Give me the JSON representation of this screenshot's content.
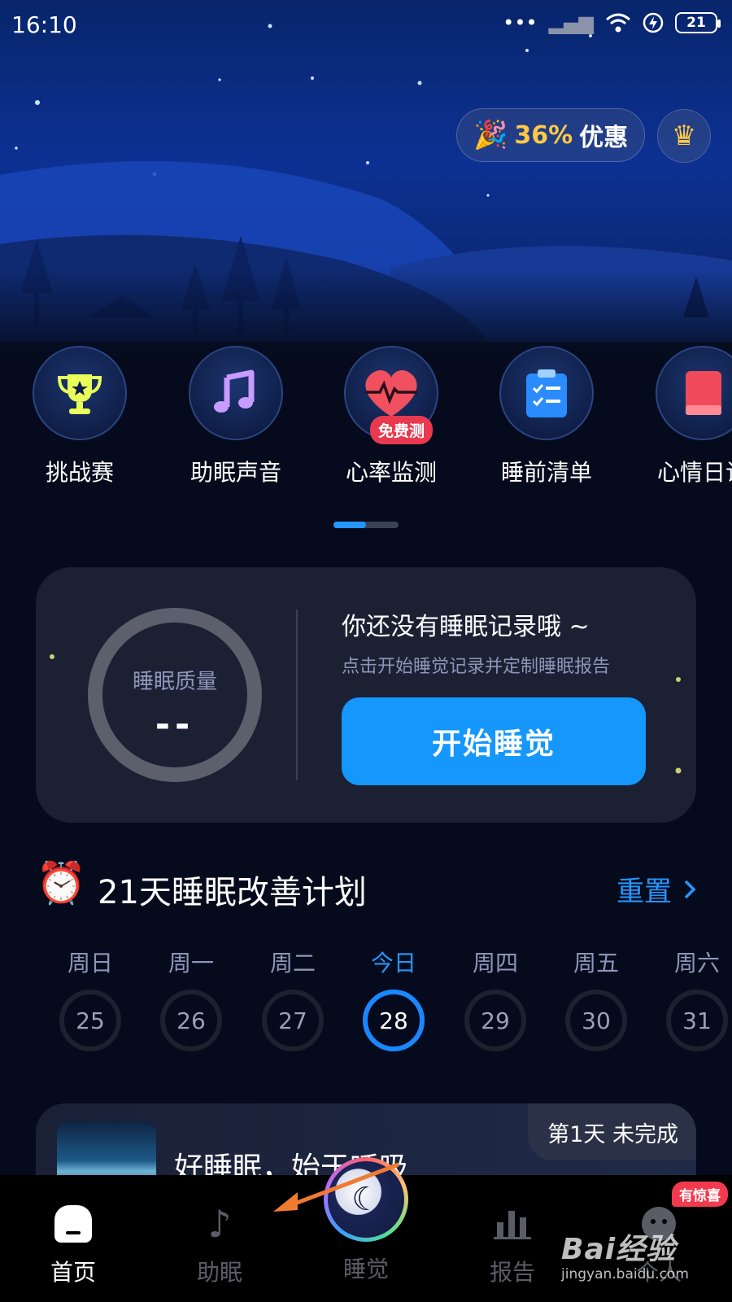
{
  "status_bar": {
    "time": "16:10",
    "battery": "21"
  },
  "promo": {
    "percent": "36%",
    "label": "优惠"
  },
  "shortcuts": [
    {
      "label": "挑战赛",
      "icon": "trophy-icon"
    },
    {
      "label": "助眠声音",
      "icon": "music-note-icon"
    },
    {
      "label": "心率监测",
      "icon": "heart-rate-icon",
      "badge": "免费测"
    },
    {
      "label": "睡前清单",
      "icon": "checklist-icon"
    },
    {
      "label": "心情日记",
      "icon": "diary-book-icon"
    }
  ],
  "sleep_card": {
    "quality_label": "睡眠质量",
    "quality_value": "--",
    "title": "你还没有睡眠记录哦 ~",
    "subtitle": "点击开始睡觉记录并定制睡眠报告",
    "start_button": "开始睡觉"
  },
  "plan": {
    "title": "21天睡眠改善计划",
    "reset_label": "重置",
    "days": [
      {
        "name": "周日",
        "date": "25",
        "active": false
      },
      {
        "name": "周一",
        "date": "26",
        "active": false
      },
      {
        "name": "周二",
        "date": "27",
        "active": false
      },
      {
        "name": "今日",
        "date": "28",
        "active": true
      },
      {
        "name": "周四",
        "date": "29",
        "active": false
      },
      {
        "name": "周五",
        "date": "30",
        "active": false
      },
      {
        "name": "周六",
        "date": "31",
        "active": false
      }
    ]
  },
  "lesson": {
    "title": "好睡眠，始于呼吸",
    "status": "第1天 未完成"
  },
  "bottom_nav": {
    "home": "首页",
    "sleep_aid": "助眠",
    "sleep": "睡觉",
    "report": "报告",
    "profile": "个人",
    "surprise_badge": "有惊喜"
  },
  "watermark": {
    "logo": "Bai经验",
    "url": "jingyan.baidu.com"
  },
  "colors": {
    "accent": "#1597fb",
    "promo": "#ffc845",
    "badge": "#e9394e",
    "background": "#050b1c"
  }
}
